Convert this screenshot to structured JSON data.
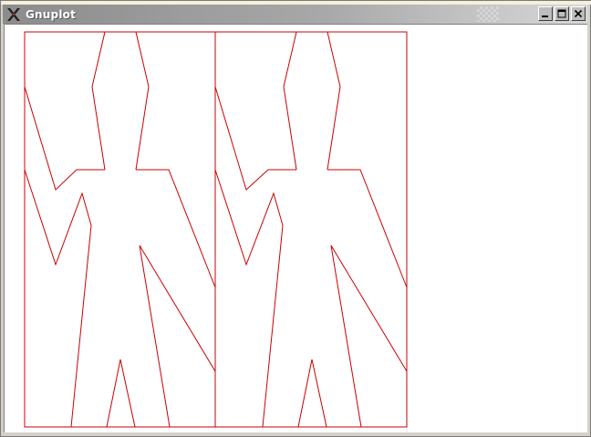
{
  "window": {
    "title": "Gnuplot",
    "app_icon": "x-logo-icon",
    "buttons": [
      {
        "name": "minimize-icon"
      },
      {
        "name": "maximize-icon"
      },
      {
        "name": "close-icon"
      }
    ]
  },
  "colors": {
    "plot_line": "#cc0000",
    "titlebar_start": "#8c8c8c",
    "titlebar_end": "#d8d8d8",
    "canvas": "#ffffff"
  }
}
